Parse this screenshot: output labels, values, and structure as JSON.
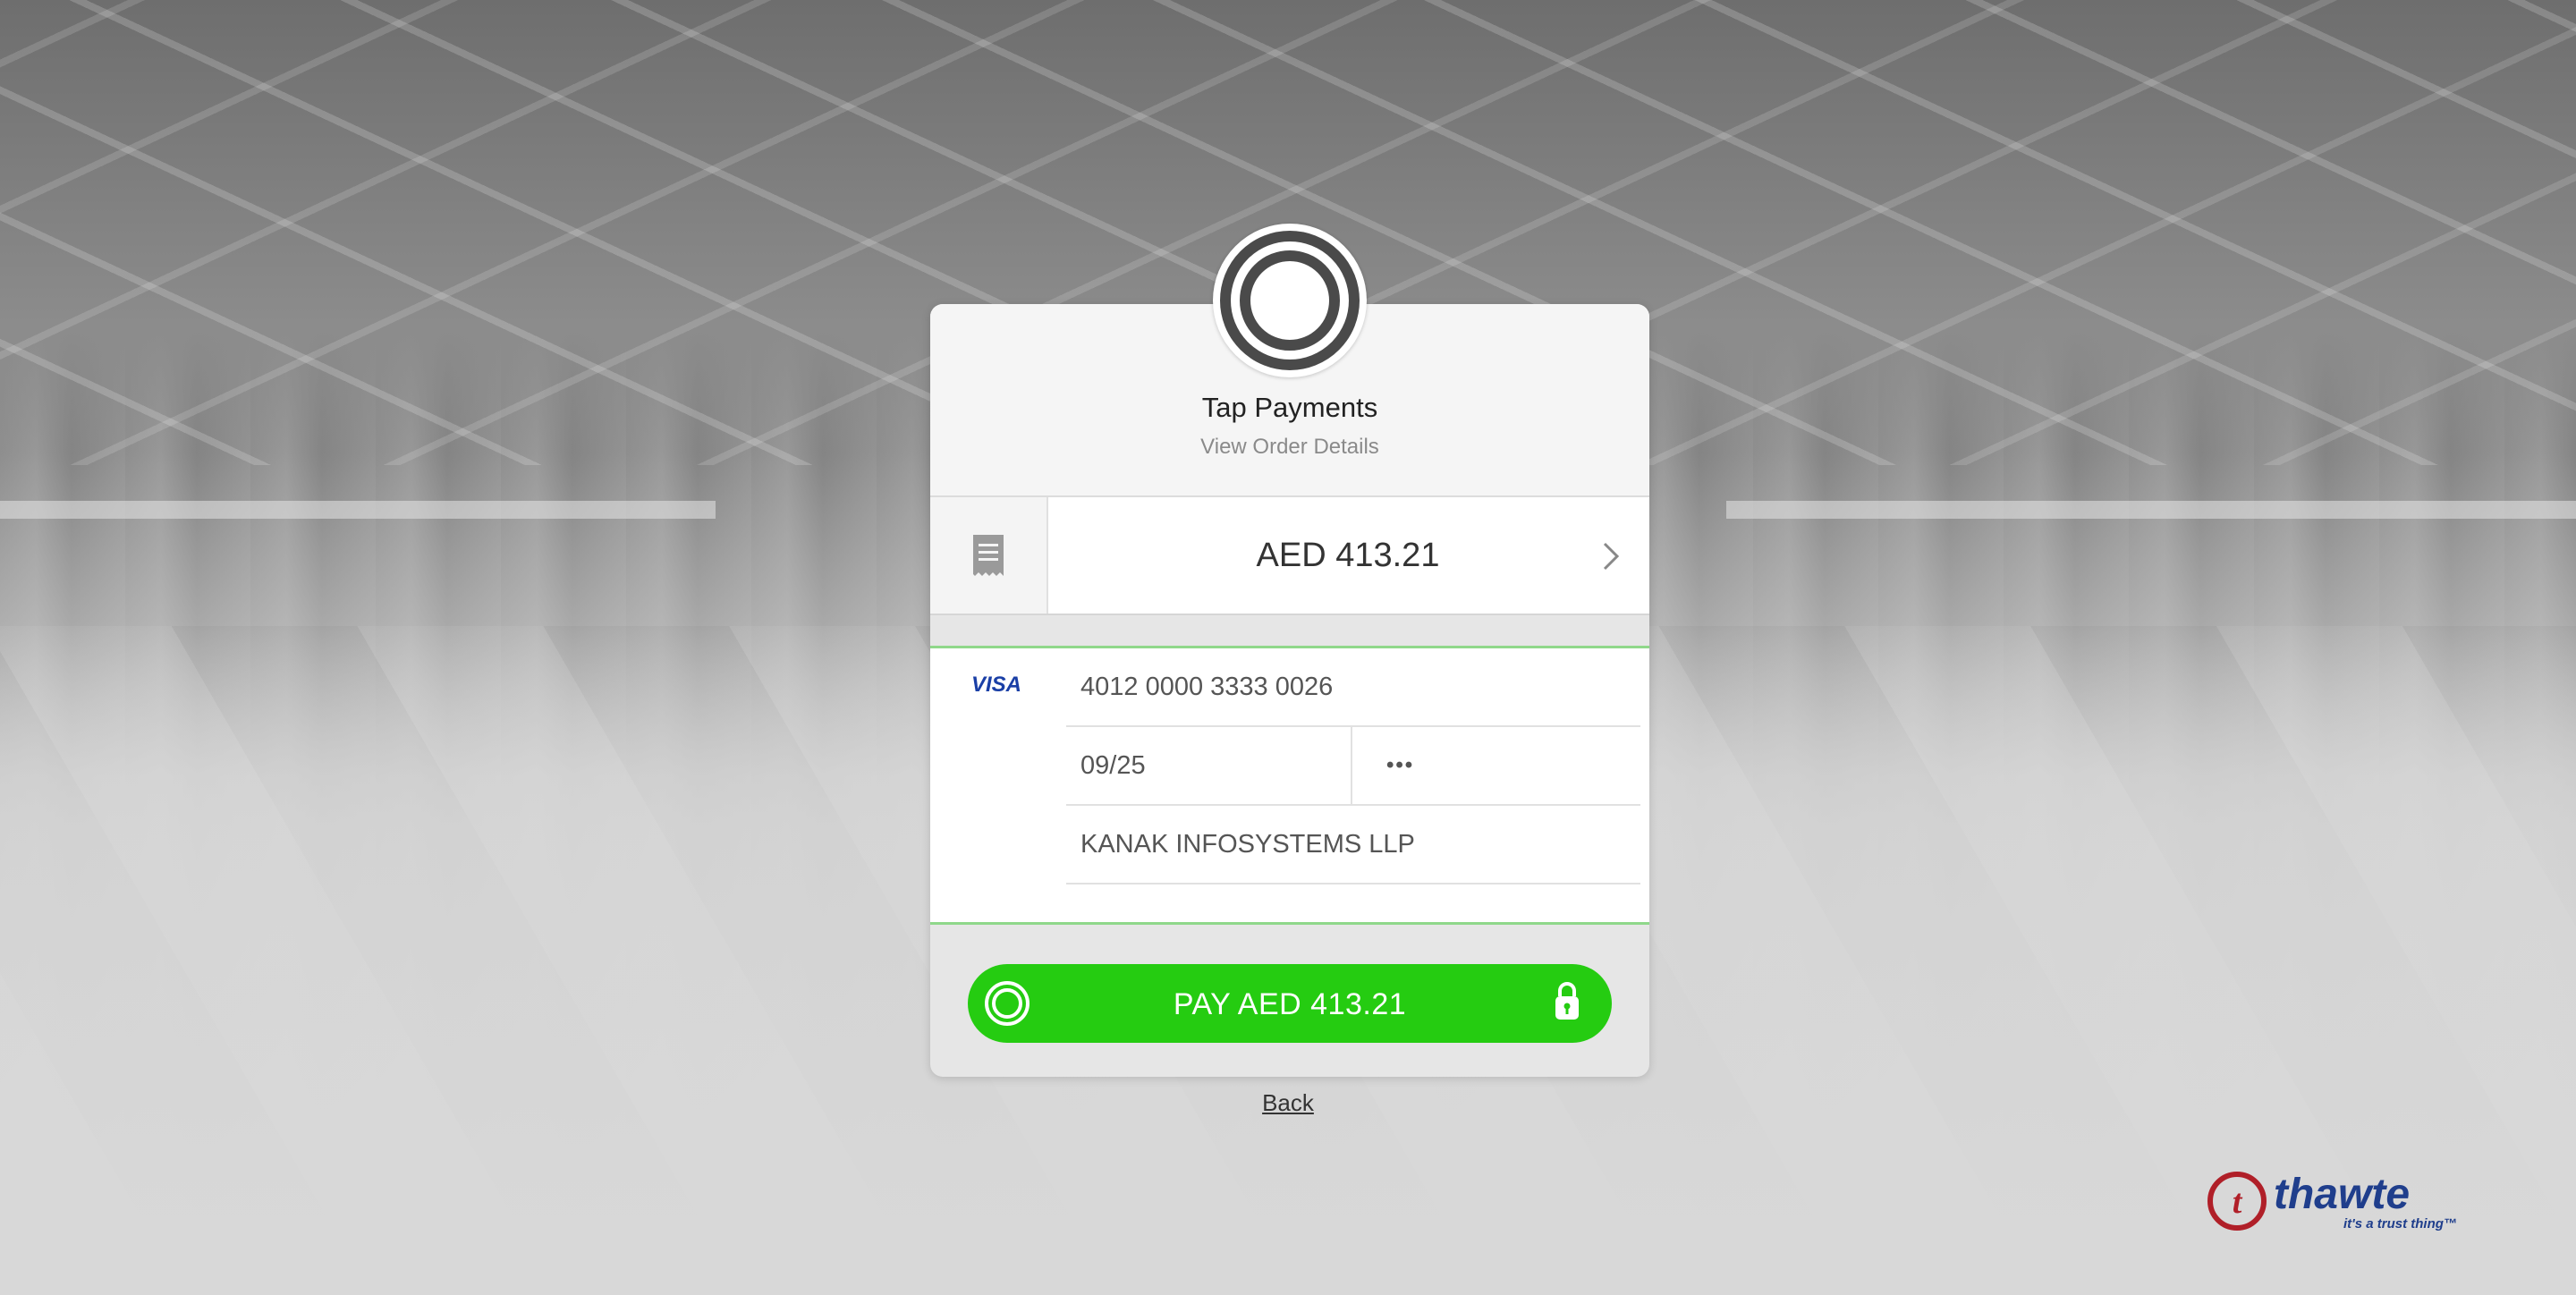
{
  "merchant": {
    "name": "Tap Payments",
    "order_details_link": "View Order Details"
  },
  "order": {
    "amount": "AED 413.21"
  },
  "card": {
    "brand_icon": "visa-icon",
    "number": "4012 0000 3333 0026",
    "expiry": "09/25",
    "cvv": "•••",
    "holder_name": "KANAK INFOSYSTEMS LLP"
  },
  "actions": {
    "pay_label": "PAY AED 413.21",
    "back_label": "Back"
  },
  "trust_badge": {
    "brand": "thawte",
    "tagline": "it's a trust thing™"
  },
  "colors": {
    "pay_button": "#25cc11",
    "form_border": "#8fd88a",
    "brand_blue": "#1f3e8c",
    "brand_red": "#b01f28"
  }
}
